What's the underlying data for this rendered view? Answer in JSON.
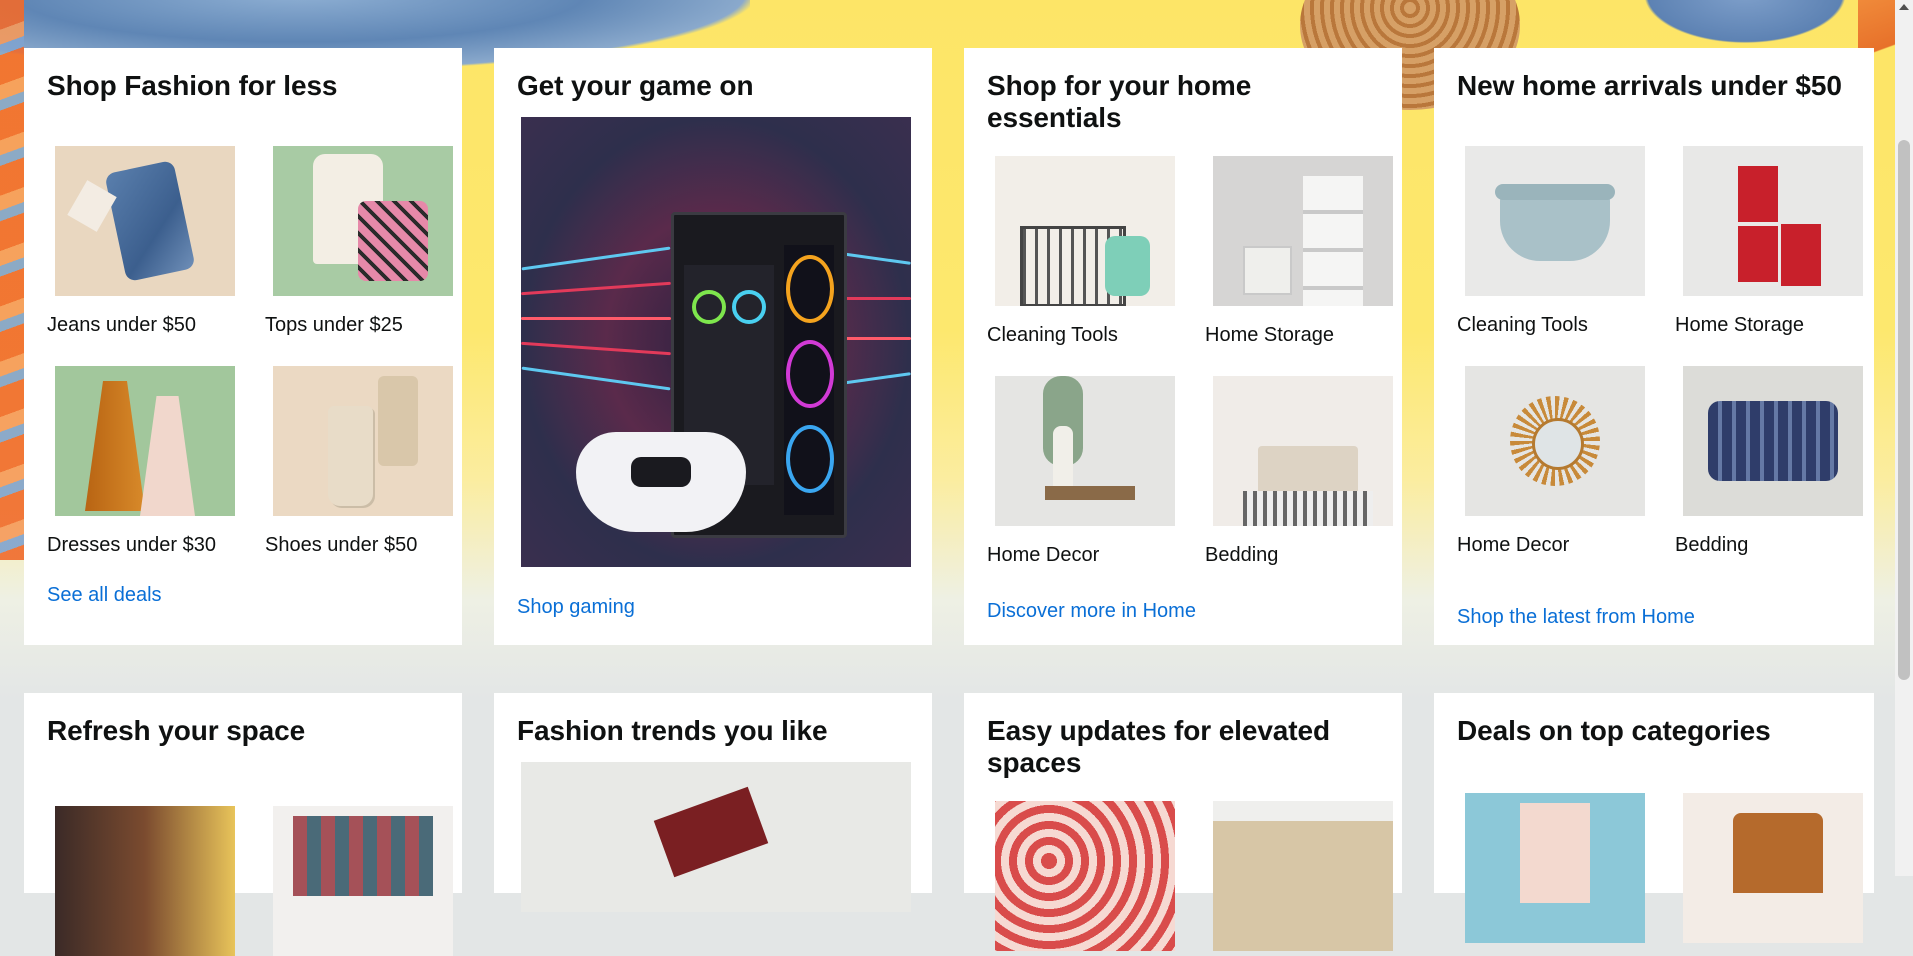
{
  "row1": [
    {
      "title": "Shop Fashion for less",
      "items": [
        {
          "label": "Jeans under $50",
          "icon": "jeans-image"
        },
        {
          "label": "Tops under $25",
          "icon": "tops-image"
        },
        {
          "label": "Dresses under $30",
          "icon": "dresses-image"
        },
        {
          "label": "Shoes under $50",
          "icon": "shoes-image"
        }
      ],
      "link": "See all deals"
    },
    {
      "title": "Get your game on",
      "image": "gaming-pc-image",
      "link": "Shop gaming"
    },
    {
      "title": "Shop for your home essentials",
      "items": [
        {
          "label": "Cleaning Tools",
          "icon": "cleaning-tools-image"
        },
        {
          "label": "Home Storage",
          "icon": "home-storage-image"
        },
        {
          "label": "Home Decor",
          "icon": "home-decor-image"
        },
        {
          "label": "Bedding",
          "icon": "bedding-image"
        }
      ],
      "link": "Discover more in Home"
    },
    {
      "title": "New home arrivals under $50",
      "items": [
        {
          "label": "Cleaning Tools",
          "icon": "dutch-oven-image"
        },
        {
          "label": "Home Storage",
          "icon": "canisters-image"
        },
        {
          "label": "Home Decor",
          "icon": "mirror-image"
        },
        {
          "label": "Bedding",
          "icon": "pillow-image"
        }
      ],
      "link": "Shop the latest from Home"
    }
  ],
  "row2": [
    {
      "title": "Refresh your space"
    },
    {
      "title": "Fashion trends you like"
    },
    {
      "title": "Easy updates for elevated spaces"
    },
    {
      "title": "Deals on top categories"
    }
  ],
  "colors": {
    "link": "#0a6fd6",
    "hero_yellow": "#fde567",
    "page_bg": "#e3e6e6"
  }
}
